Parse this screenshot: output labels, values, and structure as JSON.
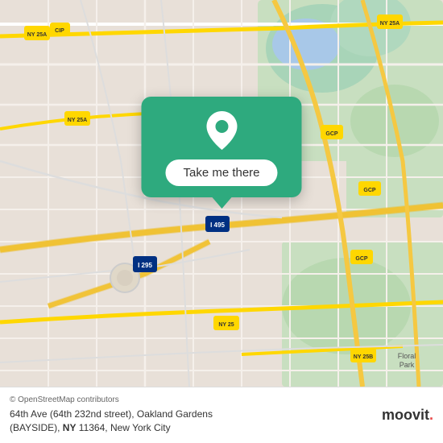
{
  "map": {
    "background_color": "#e8e0d8",
    "center_lat": 40.73,
    "center_lng": -73.77
  },
  "popup": {
    "button_label": "Take me there",
    "background_color": "#2eaa7e"
  },
  "bottom_bar": {
    "osm_credit": "© OpenStreetMap contributors",
    "address_line1": "64th Ave (64th 232nd street), Oakland Gardens",
    "address_line2": "(BAYSIDE), <B>NY</B> 11364, New York City",
    "logo_text": "moovit"
  }
}
